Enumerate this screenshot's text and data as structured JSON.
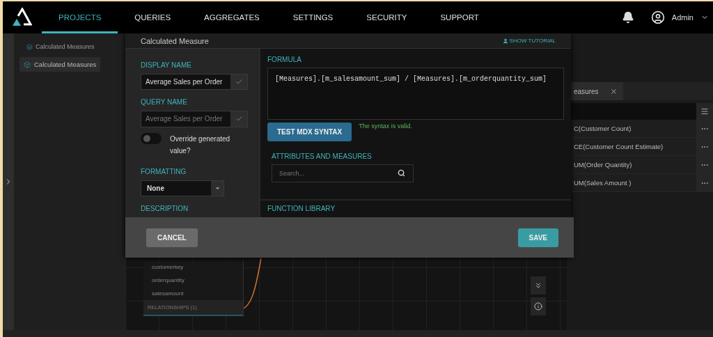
{
  "nav": {
    "items": [
      {
        "label": "PROJECTS",
        "selected": true
      },
      {
        "label": "QUERIES",
        "selected": false
      },
      {
        "label": "AGGREGATES",
        "selected": false
      },
      {
        "label": "SETTINGS",
        "selected": false
      },
      {
        "label": "SECURITY",
        "selected": false
      },
      {
        "label": "SUPPORT",
        "selected": false
      }
    ],
    "user": "Admin"
  },
  "breadcrumb": "Calculated Measures",
  "sidebar": {
    "button": "Calculated Measures"
  },
  "measures_panel": {
    "tab": "easures",
    "rows": [
      "C(Customer Count)",
      "CE(Customer Count Estimate)",
      "UM(Order Quantity)",
      "UM(Sales Amount )"
    ]
  },
  "canvas": {
    "fields": [
      "customerkey",
      "orderquantity",
      "salesamount"
    ],
    "relationships": "RELATIONSHIPS (1)"
  },
  "dialog": {
    "title": "Calculated Measure",
    "tutorial": "SHOW TUTORIAL",
    "display_name": {
      "label": "DISPLAY NAME",
      "value": "Average Sales per Order",
      "valid": true
    },
    "query_name": {
      "label": "QUERY NAME",
      "placeholder": "Average Sales per Order",
      "valid": true
    },
    "override": {
      "label": "Override generated value?",
      "on": false
    },
    "formatting": {
      "label": "FORMATTING",
      "value": "None"
    },
    "description_label": "DESCRIPTION",
    "formula": {
      "label": "FORMULA",
      "value": "[Measures].[m_salesamount_sum] / [Measures].[m_orderquantity_sum]"
    },
    "test_button": "TEST MDX SYNTAX",
    "syntax_message": "The syntax is valid.",
    "attributes": {
      "label": "ATTRIBUTES AND MEASURES",
      "placeholder": "Search..."
    },
    "function_library": "FUNCTION LIBRARY",
    "buttons": {
      "cancel": "CANCEL",
      "save": "SAVE"
    }
  }
}
